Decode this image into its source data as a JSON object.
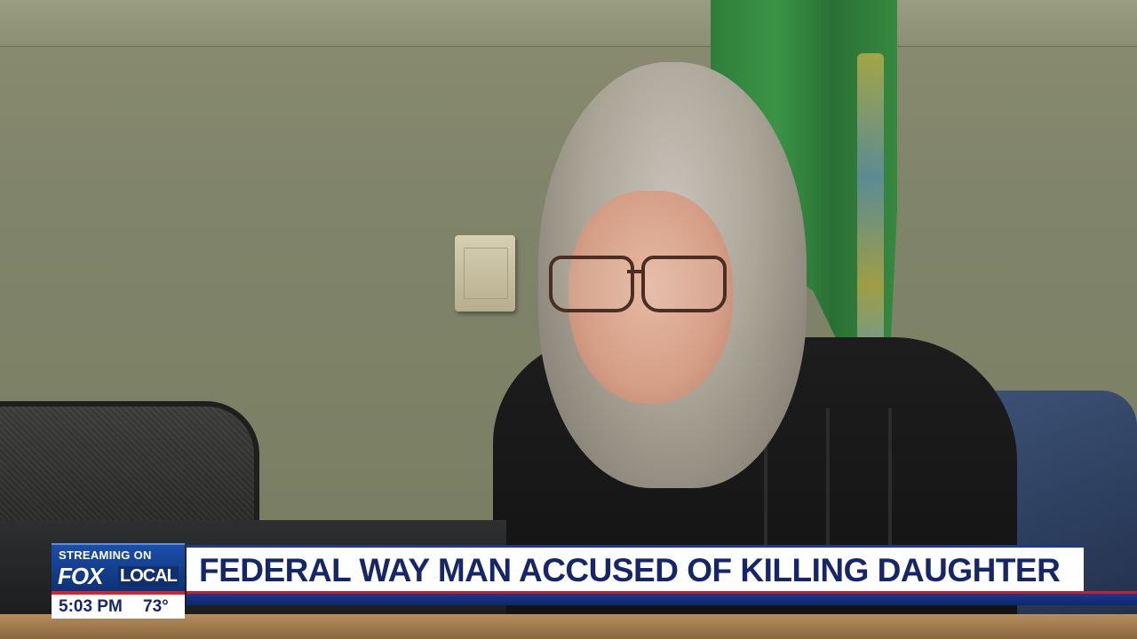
{
  "broadcast": {
    "logo": {
      "streaming_label": "STREAMING ON",
      "brand_fox": "FOX",
      "brand_local": "LOCAL"
    },
    "headline": "FEDERAL WAY MAN ACCUSED OF KILLING DAUGHTER",
    "time": "5:03 PM",
    "temperature": "73°"
  },
  "colors": {
    "headline_text": "#16266a",
    "brand_blue": "#0d2f72",
    "accent_red": "#d8232a"
  }
}
